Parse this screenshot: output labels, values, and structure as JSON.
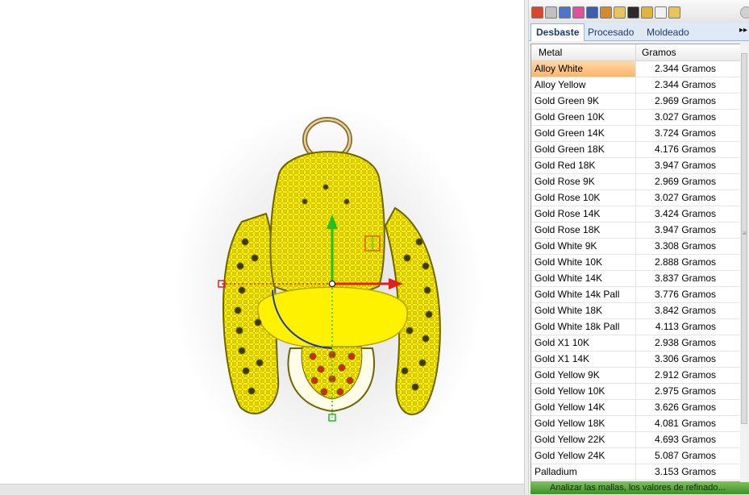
{
  "toolbar": {
    "icons": [
      {
        "name": "material-icon",
        "color": "#d9482b"
      },
      {
        "name": "layers-icon",
        "color": "#c0c0c0"
      },
      {
        "name": "display-icon",
        "color": "#4a77c9"
      },
      {
        "name": "color-wheel-icon",
        "color": "#e04fa0"
      },
      {
        "name": "sphere-icon",
        "color": "#3a5fb0"
      },
      {
        "name": "pencil-icon",
        "color": "#d68b2a"
      },
      {
        "name": "folder-icon",
        "color": "#e8c45a"
      },
      {
        "name": "rg-plugin-icon",
        "color": "#2b2b2b"
      },
      {
        "name": "gem-icon",
        "color": "#e0b43a"
      },
      {
        "name": "clock-icon",
        "color": "#f2f2f2"
      },
      {
        "name": "weight-icon",
        "color": "#e8c45a"
      }
    ],
    "settings_icon": "gear-icon"
  },
  "tabs": [
    {
      "label": "Desbaste",
      "active": true
    },
    {
      "label": "Procesado",
      "active": false
    },
    {
      "label": "Moldeado",
      "active": false
    }
  ],
  "tab_scroll_glyph": "▸▸",
  "table": {
    "headers": {
      "metal": "Metal",
      "grams": "Gramos"
    },
    "rows": [
      {
        "metal": "Alloy White",
        "value": "2.344 Gramos"
      },
      {
        "metal": "Alloy Yellow",
        "value": "2.344 Gramos"
      },
      {
        "metal": "Gold Green 9K",
        "value": "2.969 Gramos"
      },
      {
        "metal": "Gold Green 10K",
        "value": "3.027 Gramos"
      },
      {
        "metal": "Gold Green 14K",
        "value": "3.724 Gramos"
      },
      {
        "metal": "Gold Green 18K",
        "value": "4.176 Gramos"
      },
      {
        "metal": "Gold Red 18K",
        "value": "3.947 Gramos"
      },
      {
        "metal": "Gold Rose 9K",
        "value": "2.969 Gramos"
      },
      {
        "metal": "Gold Rose 10K",
        "value": "3.027 Gramos"
      },
      {
        "metal": "Gold Rose 14K",
        "value": "3.424 Gramos"
      },
      {
        "metal": "Gold Rose 18K",
        "value": "3.947 Gramos"
      },
      {
        "metal": "Gold White 9K",
        "value": "3.308 Gramos"
      },
      {
        "metal": "Gold White 10K",
        "value": "2.888 Gramos"
      },
      {
        "metal": "Gold White 14K",
        "value": "3.837 Gramos"
      },
      {
        "metal": "Gold White 14k Pall",
        "value": "3.776 Gramos"
      },
      {
        "metal": "Gold White 18K",
        "value": "3.842 Gramos"
      },
      {
        "metal": "Gold White 18k Pall",
        "value": "4.113 Gramos"
      },
      {
        "metal": "Gold X1 10K",
        "value": "2.938 Gramos"
      },
      {
        "metal": "Gold X1 14K",
        "value": "3.306 Gramos"
      },
      {
        "metal": "Gold Yellow 9K",
        "value": "2.912 Gramos"
      },
      {
        "metal": "Gold Yellow 10K",
        "value": "2.975 Gramos"
      },
      {
        "metal": "Gold Yellow 14K",
        "value": "3.626 Gramos"
      },
      {
        "metal": "Gold Yellow 18K",
        "value": "4.081 Gramos"
      },
      {
        "metal": "Gold Yellow 22K",
        "value": "4.693 Gramos"
      },
      {
        "metal": "Gold Yellow 24K",
        "value": "5.087 Gramos"
      },
      {
        "metal": "Palladium",
        "value": "3.153 Gramos"
      }
    ],
    "selected_index": 0
  },
  "status": {
    "text": "Analizar las mallas, los valores de refinado..."
  },
  "viewport": {
    "model_color": "#fff200",
    "gizmo": {
      "x_axis_color": "#e02020",
      "y_axis_color": "#22c022",
      "rotation_color": "#2233bb"
    }
  }
}
